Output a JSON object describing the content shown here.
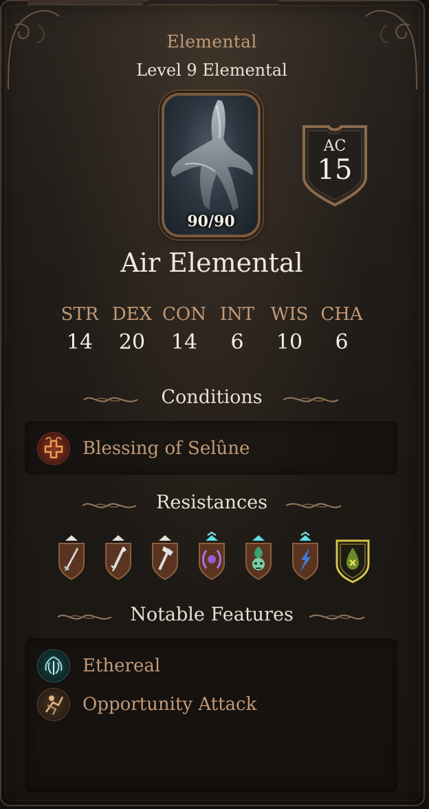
{
  "creature": {
    "race": "Elemental",
    "level_line": "Level 9 Elemental",
    "hp": "90/90",
    "ac_label": "AC",
    "ac_value": "15",
    "name": "Air Elemental"
  },
  "abilities": [
    {
      "key": "STR",
      "value": "14"
    },
    {
      "key": "DEX",
      "value": "20"
    },
    {
      "key": "CON",
      "value": "14"
    },
    {
      "key": "INT",
      "value": "6"
    },
    {
      "key": "WIS",
      "value": "10"
    },
    {
      "key": "CHA",
      "value": "6"
    }
  ],
  "sections": {
    "conditions": "Conditions",
    "resistances": "Resistances",
    "features": "Notable Features"
  },
  "conditions": [
    {
      "label": "Blessing of Selûne",
      "icon": "blessing-icon"
    }
  ],
  "resistances": [
    {
      "icon": "slashing-icon",
      "color": "#cfcfcf"
    },
    {
      "icon": "piercing-icon",
      "color": "#cfcfcf"
    },
    {
      "icon": "bludgeoning-icon",
      "color": "#cfcfcf"
    },
    {
      "icon": "thunder-icon",
      "color": "#b06ad8"
    },
    {
      "icon": "poison-icon",
      "color": "#4fb088"
    },
    {
      "icon": "lightning-icon",
      "color": "#3d7ae0"
    },
    {
      "icon": "poison-immune-icon",
      "color": "#d8c84a"
    }
  ],
  "features": [
    {
      "label": "Ethereal",
      "icon": "ethereal-icon"
    },
    {
      "label": "Opportunity Attack",
      "icon": "opportunity-attack-icon"
    }
  ],
  "colors": {
    "accent_text": "#c29a78",
    "bright_text": "#efe9e0",
    "frame": "#7a5a3e"
  }
}
